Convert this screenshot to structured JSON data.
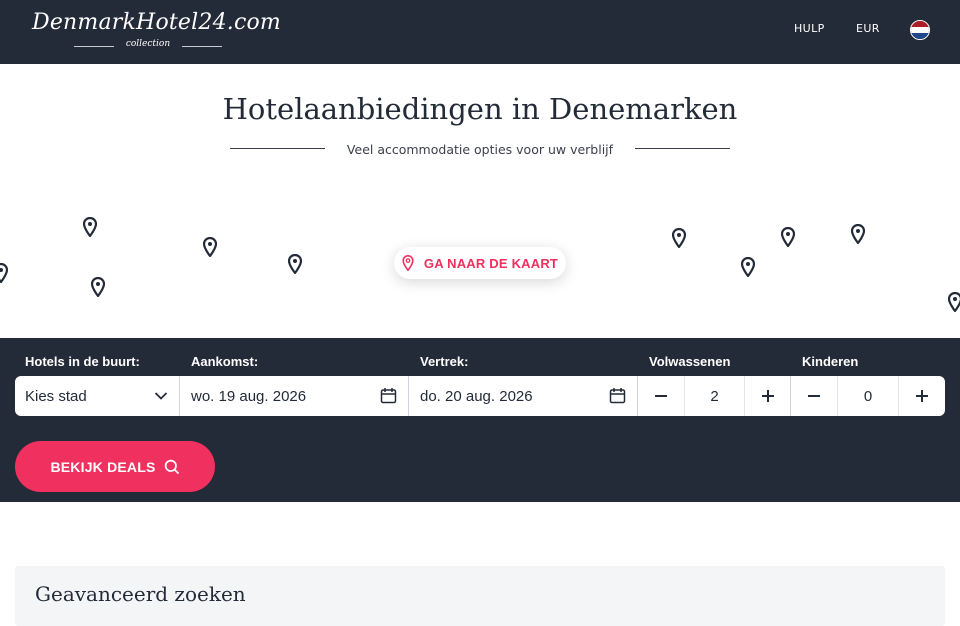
{
  "header": {
    "logo_main": "DenmarkHotel24.com",
    "logo_sub": "collection",
    "nav": [
      {
        "label": "HULP"
      },
      {
        "label": "EUR"
      }
    ],
    "flag_colors": [
      "#ae1c28",
      "#ffffff",
      "#21468b"
    ]
  },
  "hero": {
    "title": "Hotelaanbiedingen in Denemarken",
    "subtitle": "Veel accommodatie opties voor uw verblijf",
    "map_button": "GA NAAR DE KAART"
  },
  "search": {
    "labels": {
      "city": "Hotels in de buurt:",
      "checkin": "Aankomst:",
      "checkout": "Vertrek:",
      "adults": "Volwassenen",
      "children": "Kinderen"
    },
    "city_value": "Kies stad",
    "checkin_value": "wo. 19 aug. 2026",
    "checkout_value": "do. 20 aug. 2026",
    "adults_value": "2",
    "children_value": "0",
    "deals_button": "BEKIJK DEALS"
  },
  "advanced": {
    "title": "Geavanceerd zoeken"
  },
  "colors": {
    "dark": "#232a38",
    "accent": "#f0305f"
  }
}
